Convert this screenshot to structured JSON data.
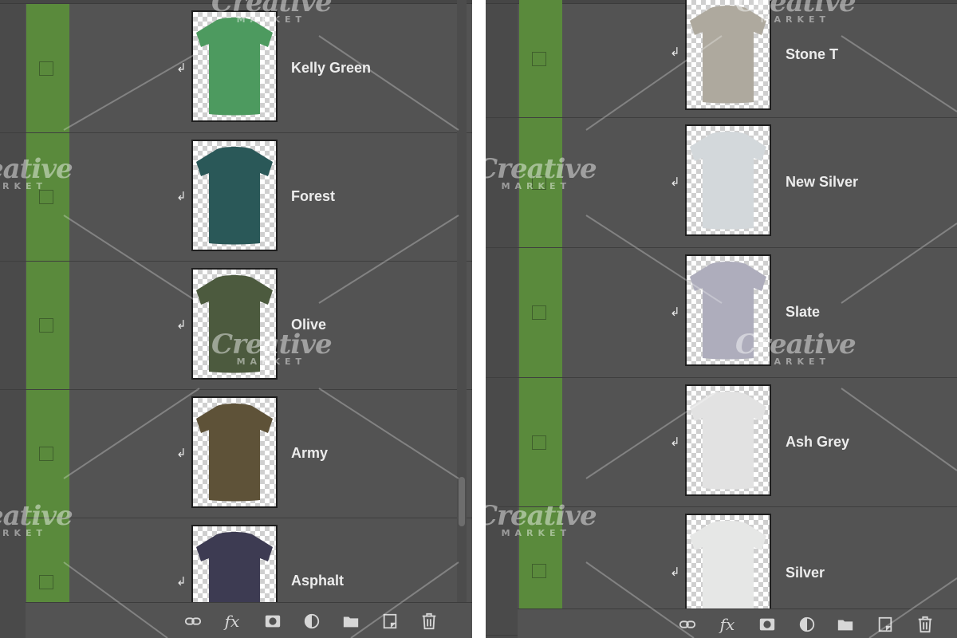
{
  "panels": [
    {
      "layers": [
        {
          "name": "Kelly Green",
          "color": "#4d9a5f"
        },
        {
          "name": "Forest",
          "color": "#2a5858"
        },
        {
          "name": "Olive",
          "color": "#4c5a3e"
        },
        {
          "name": "Army",
          "color": "#5e5238"
        },
        {
          "name": "Asphalt",
          "color": "#3d3b52"
        }
      ]
    },
    {
      "layers": [
        {
          "name": "Stone T",
          "color": "#aea99e"
        },
        {
          "name": "New Silver",
          "color": "#d3d8db"
        },
        {
          "name": "Slate",
          "color": "#aeadbc"
        },
        {
          "name": "Ash Grey",
          "color": "#e2e2e2"
        },
        {
          "name": "Silver",
          "color": "#e6e7e6"
        }
      ]
    }
  ],
  "clip_glyph": "↲",
  "toolbar": {
    "fx_label": "fx",
    "icons": [
      "link-icon",
      "fx-icon",
      "mask-icon",
      "adjustment-icon",
      "folder-icon",
      "new-layer-icon",
      "trash-icon"
    ]
  },
  "watermark": {
    "line1": "Creative",
    "line2": "MARKET"
  },
  "colors": {
    "panel": "#535353",
    "visibility_column": "#5a8a3c",
    "text": "#ececec"
  }
}
